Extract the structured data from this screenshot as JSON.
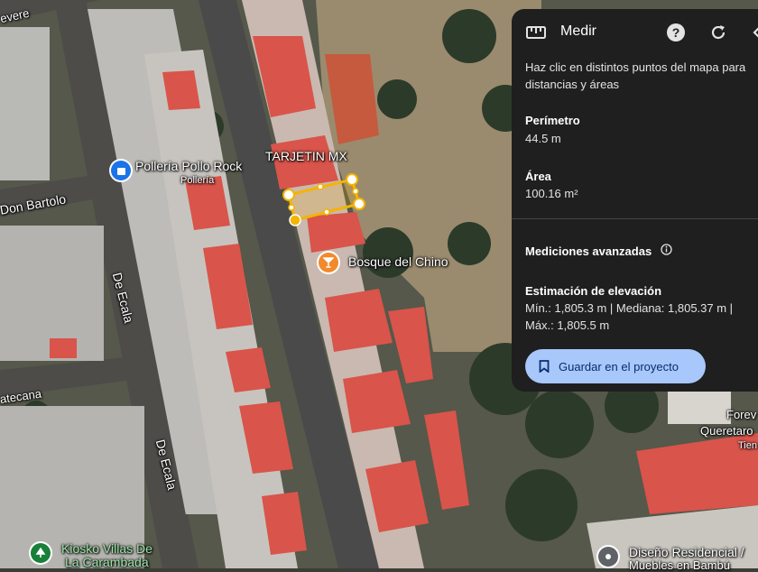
{
  "panel": {
    "title": "Medir",
    "help_icon": "help-circle-icon",
    "refresh_icon": "refresh-icon",
    "ruler_icon": "ruler-icon",
    "instruction_line1": "Haz clic en distintos puntos del mapa para",
    "instruction_line2": "distancias y áreas",
    "perimeter_label": "Perímetro",
    "perimeter_value": "44.5 m",
    "area_label": "Área",
    "area_value": "100.16 m²",
    "advanced_label": "Mediciones avanzadas",
    "elevation_label": "Estimación de elevación",
    "elevation_line1": "Mín.: 1,805.3 m | Mediana: 1,805.37 m |",
    "elevation_line2": "Máx.: 1,805.5 m",
    "save_label": "Guardar en el proyecto",
    "save_icon": "bookmark-icon"
  },
  "map": {
    "streets": {
      "devere": "evere",
      "don_bartolo": "Don Bartolo",
      "de_ecala_1": "De Ecala",
      "de_ecala_2": "De Ecala",
      "atecana": "atecana"
    },
    "places": {
      "polleria_name": "Pollería Pollo Rock",
      "polleria_sub": "Pollería",
      "tarjetin": "TARJETIN MX",
      "bosque": "Bosque del Chino",
      "forev1": "Forev",
      "forev2": "Queretaro",
      "forev3": "Tien",
      "kiosko1": "Kiosko Villas De",
      "kiosko2": "La Carambada",
      "diseno1": "Diseño Residencial /",
      "diseno2": "Muebles en Bambú"
    },
    "colors": {
      "measure": "#f4b400",
      "roof": "#d9544a",
      "road": "#4a4a4a"
    }
  }
}
